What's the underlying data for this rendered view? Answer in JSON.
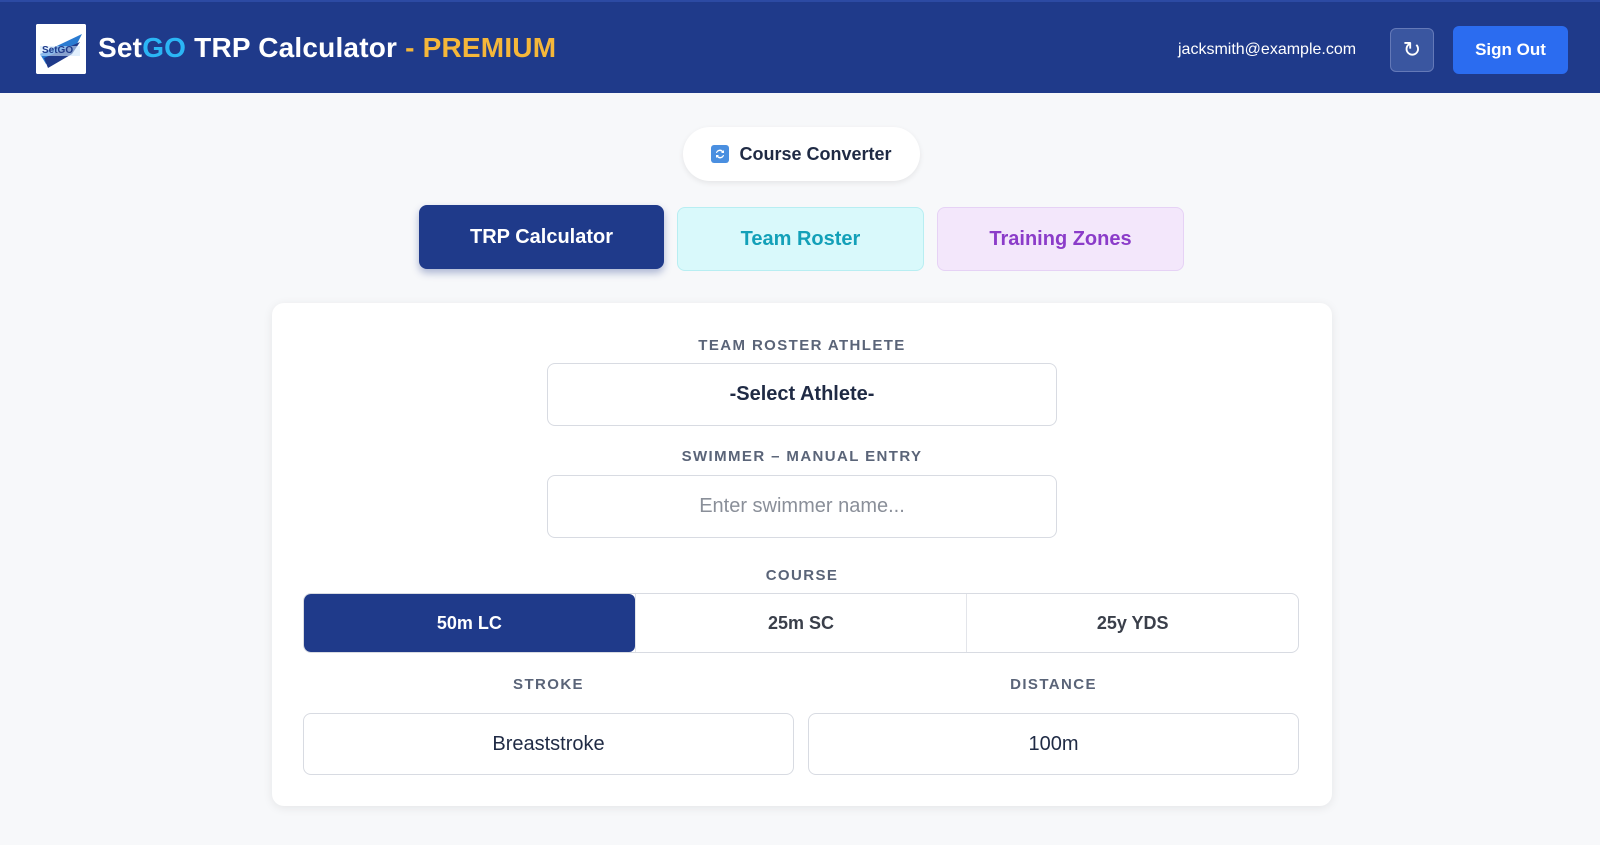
{
  "header": {
    "title_set": "Set",
    "title_go": "GO",
    "title_rest": " TRP Calculator",
    "title_premium": " - PREMIUM",
    "user_email": "jacksmith@example.com",
    "refresh_glyph": "↻",
    "signout_label": "Sign Out",
    "logo_icon": "setgo-trpc-logo"
  },
  "converter": {
    "label": "Course Converter",
    "icon": "convert-icon"
  },
  "tabs": [
    {
      "label": "TRP Calculator",
      "active": true
    },
    {
      "label": "Team Roster",
      "active": false
    },
    {
      "label": "Training Zones",
      "active": false
    }
  ],
  "form": {
    "athlete_label": "TEAM ROSTER ATHLETE",
    "athlete_value": "-Select Athlete-",
    "swimmer_label": "SWIMMER – MANUAL ENTRY",
    "swimmer_placeholder": "Enter swimmer name...",
    "course_label": "COURSE",
    "course_options": [
      "50m LC",
      "25m SC",
      "25y YDS"
    ],
    "course_selected": "50m LC",
    "stroke_label": "STROKE",
    "stroke_value": "Breaststroke",
    "distance_label": "DISTANCE",
    "distance_value": "100m"
  },
  "colors": {
    "header_bg": "#1f3a8a",
    "accent_blue": "#2b6cf0",
    "go_cyan": "#2bb6f5",
    "premium_gold": "#f5b73a",
    "roster_teal": "#13a0b8",
    "zones_purple": "#8b3cc9"
  }
}
